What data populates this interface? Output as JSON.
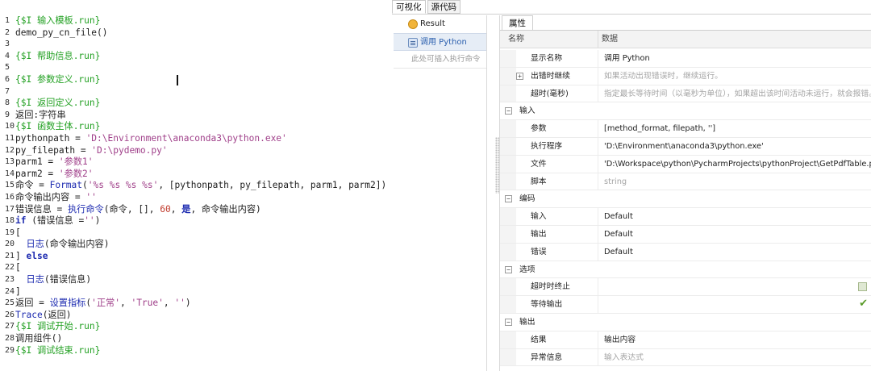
{
  "code_editor": {
    "lines": [
      {
        "n": "1",
        "tokens": [
          {
            "t": "{$I 输入模板.run}",
            "c": "comment"
          }
        ]
      },
      {
        "n": "2",
        "tokens": [
          {
            "t": "demo_py_cn_file()",
            "c": "plain"
          }
        ]
      },
      {
        "n": "3",
        "tokens": []
      },
      {
        "n": "4",
        "tokens": [
          {
            "t": "{$I 帮助信息.run}",
            "c": "comment"
          }
        ]
      },
      {
        "n": "5",
        "tokens": []
      },
      {
        "n": "6",
        "tokens": [
          {
            "t": "{$I 参数定义.run}",
            "c": "comment"
          }
        ]
      },
      {
        "n": "7",
        "tokens": []
      },
      {
        "n": "8",
        "tokens": [
          {
            "t": "{$I 返回定义.run}",
            "c": "comment"
          }
        ]
      },
      {
        "n": "9",
        "tokens": [
          {
            "t": "返回:字符串",
            "c": "plain"
          }
        ]
      },
      {
        "n": "10",
        "tokens": [
          {
            "t": "{$I 函数主体.run}",
            "c": "comment"
          }
        ]
      },
      {
        "n": "11",
        "tokens": [
          {
            "t": "pythonpath = ",
            "c": "plain"
          },
          {
            "t": "'D:\\Environment\\anaconda3\\python.exe'",
            "c": "string"
          }
        ]
      },
      {
        "n": "12",
        "tokens": [
          {
            "t": "py_filepath = ",
            "c": "plain"
          },
          {
            "t": "'D:\\pydemo.py'",
            "c": "string"
          }
        ]
      },
      {
        "n": "13",
        "tokens": [
          {
            "t": "parm1 = ",
            "c": "plain"
          },
          {
            "t": "'参数1'",
            "c": "string"
          }
        ]
      },
      {
        "n": "14",
        "tokens": [
          {
            "t": "parm2 = ",
            "c": "plain"
          },
          {
            "t": "'参数2'",
            "c": "string"
          }
        ]
      },
      {
        "n": "15",
        "tokens": [
          {
            "t": "命令 = ",
            "c": "plain"
          },
          {
            "t": "Format",
            "c": "func"
          },
          {
            "t": "(",
            "c": "plain"
          },
          {
            "t": "'%s %s %s %s'",
            "c": "string"
          },
          {
            "t": ", [pythonpath, py_filepath, parm1, parm2])",
            "c": "plain"
          }
        ]
      },
      {
        "n": "16",
        "tokens": [
          {
            "t": "命令输出内容 = ",
            "c": "plain"
          },
          {
            "t": "''",
            "c": "string"
          }
        ]
      },
      {
        "n": "17",
        "tokens": [
          {
            "t": "错误信息 = ",
            "c": "plain"
          },
          {
            "t": "执行命令",
            "c": "func"
          },
          {
            "t": "(命令, [], ",
            "c": "plain"
          },
          {
            "t": "60",
            "c": "number"
          },
          {
            "t": ", ",
            "c": "plain"
          },
          {
            "t": "是",
            "c": "keyword"
          },
          {
            "t": ", 命令输出内容)",
            "c": "plain"
          }
        ]
      },
      {
        "n": "18",
        "tokens": [
          {
            "t": "if",
            "c": "keyword"
          },
          {
            "t": " (错误信息 =",
            "c": "plain"
          },
          {
            "t": "''",
            "c": "string"
          },
          {
            "t": ")",
            "c": "plain"
          }
        ]
      },
      {
        "n": "19",
        "tokens": [
          {
            "t": "[",
            "c": "plain"
          }
        ]
      },
      {
        "n": "20",
        "tokens": [
          {
            "t": "  ",
            "c": "plain"
          },
          {
            "t": "日志",
            "c": "func"
          },
          {
            "t": "(命令输出内容)",
            "c": "plain"
          }
        ]
      },
      {
        "n": "21",
        "tokens": [
          {
            "t": "] ",
            "c": "plain"
          },
          {
            "t": "else",
            "c": "keyword"
          }
        ]
      },
      {
        "n": "22",
        "tokens": [
          {
            "t": "[",
            "c": "plain"
          }
        ]
      },
      {
        "n": "23",
        "tokens": [
          {
            "t": "  ",
            "c": "plain"
          },
          {
            "t": "日志",
            "c": "func"
          },
          {
            "t": "(错误信息)",
            "c": "plain"
          }
        ]
      },
      {
        "n": "24",
        "tokens": [
          {
            "t": "]",
            "c": "plain"
          }
        ]
      },
      {
        "n": "25",
        "tokens": [
          {
            "t": "返回 = ",
            "c": "plain"
          },
          {
            "t": "设置指标",
            "c": "func"
          },
          {
            "t": "(",
            "c": "plain"
          },
          {
            "t": "'正常'",
            "c": "string"
          },
          {
            "t": ", ",
            "c": "plain"
          },
          {
            "t": "'True'",
            "c": "string"
          },
          {
            "t": ", ",
            "c": "plain"
          },
          {
            "t": "''",
            "c": "string"
          },
          {
            "t": ")",
            "c": "plain"
          }
        ]
      },
      {
        "n": "26",
        "tokens": [
          {
            "t": "Trace",
            "c": "func"
          },
          {
            "t": "(返回)",
            "c": "plain"
          }
        ]
      },
      {
        "n": "27",
        "tokens": [
          {
            "t": "{$I 调试开始.run}",
            "c": "comment"
          }
        ]
      },
      {
        "n": "28",
        "tokens": [
          {
            "t": "调用组件",
            "c": "plain"
          },
          {
            "t": "()",
            "c": "plain"
          }
        ]
      },
      {
        "n": "29",
        "tokens": [
          {
            "t": "{$I 调试结束.run}",
            "c": "comment"
          }
        ]
      }
    ]
  },
  "designer": {
    "view_tabs": [
      "可视化",
      "源代码"
    ],
    "steps": [
      {
        "label": "Result",
        "icon": "result-icon",
        "selected": false
      },
      {
        "label": "调用 Python",
        "icon": "python-step-icon",
        "selected": true
      }
    ],
    "insert_hint": "此处可插入执行命令",
    "properties": {
      "tab_label": "属性",
      "header_name": "名称",
      "header_data": "数据",
      "rows": [
        {
          "kind": "prop",
          "name": "显示名称",
          "value": "调用 Python",
          "hint": false
        },
        {
          "kind": "prop",
          "name": "出错时继续",
          "value": "如果活动出现错误时，继续运行。",
          "hint": true,
          "toggle": "+"
        },
        {
          "kind": "prop",
          "name": "超时(毫秒)",
          "value": "指定最长等待时间（以毫秒为单位），如果超出该时间活动未运行，就会报错。默",
          "hint": true
        },
        {
          "kind": "group",
          "name": "输入",
          "toggle": "−"
        },
        {
          "kind": "prop",
          "name": "参数",
          "value": "[method_format, filepath, '']",
          "hint": false
        },
        {
          "kind": "prop",
          "name": "执行程序",
          "value": "'D:\\Environment\\anaconda3\\python.exe'",
          "hint": false
        },
        {
          "kind": "prop",
          "name": "文件",
          "value": "'D:\\Workspace\\python\\PycharmProjects\\pythonProject\\GetPdfTable.py'",
          "hint": false
        },
        {
          "kind": "prop",
          "name": "脚本",
          "value": "string",
          "hint": true
        },
        {
          "kind": "group",
          "name": "编码",
          "toggle": "−"
        },
        {
          "kind": "prop",
          "name": "输入",
          "value": "Default",
          "hint": false
        },
        {
          "kind": "prop",
          "name": "输出",
          "value": "Default",
          "hint": false
        },
        {
          "kind": "prop",
          "name": "错误",
          "value": "Default",
          "hint": false
        },
        {
          "kind": "group",
          "name": "选项",
          "toggle": "−"
        },
        {
          "kind": "prop",
          "name": "超时时终止",
          "value": "",
          "hint": false,
          "checkbox": "unchecked"
        },
        {
          "kind": "prop",
          "name": "等待输出",
          "value": "",
          "hint": false,
          "checkbox": "checked"
        },
        {
          "kind": "group",
          "name": "输出",
          "toggle": "−"
        },
        {
          "kind": "prop",
          "name": "结果",
          "value": "输出内容",
          "hint": false
        },
        {
          "kind": "prop",
          "name": "异常信息",
          "value": "输入表达式",
          "hint": true
        }
      ]
    }
  },
  "colors": {
    "comment": "#22a022",
    "string": "#a0408a",
    "keyword": "#1d2bb0",
    "selected_step": "#e6edf6"
  }
}
